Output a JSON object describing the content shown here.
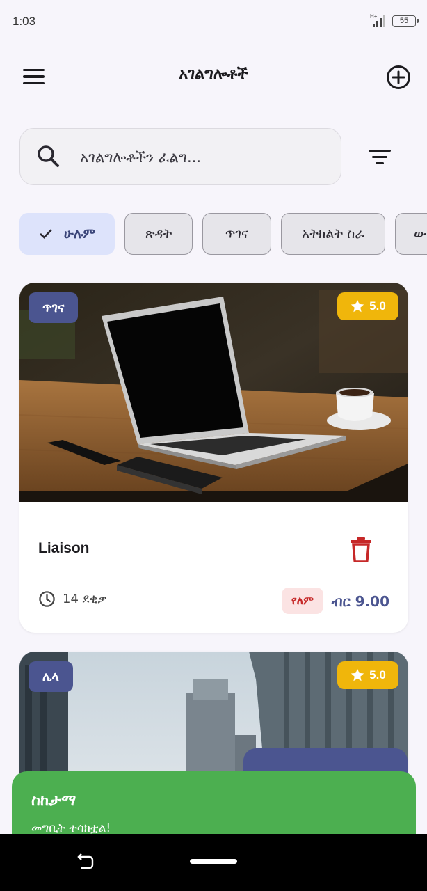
{
  "status_bar": {
    "time": "1:03",
    "battery": "55"
  },
  "app_bar": {
    "title": "አገልግሎቶች"
  },
  "search": {
    "placeholder": "አገልግሎቶችን ፈልግ..."
  },
  "filters": {
    "chips": [
      {
        "label": "ሁሉም",
        "selected": true
      },
      {
        "label": "ጽዳት",
        "selected": false
      },
      {
        "label": "ጥገና",
        "selected": false
      },
      {
        "label": "አትክልት ስራ",
        "selected": false
      },
      {
        "label": "ው",
        "selected": false
      }
    ]
  },
  "services": [
    {
      "category": "ጥገና",
      "rating": "5.0",
      "name": "Liaison",
      "duration": "14 ደቂቃ",
      "availability": "የለም",
      "price": "ብር 9.00"
    },
    {
      "category": "ሌላ",
      "rating": "5.0"
    }
  ],
  "toast": {
    "title": "ስኬታማ",
    "message": "መግቢት ተሳክቷል!"
  },
  "colors": {
    "primary": "#4b5590",
    "rating": "#f0b60b",
    "danger": "#c62828",
    "success": "#4caf50",
    "chip_selected": "#dde3fb",
    "background": "#f7f5fb"
  },
  "icons": {
    "menu": "menu-icon",
    "add": "add-circle-icon",
    "search": "search-icon",
    "filter": "filter-icon",
    "check": "check-icon",
    "star": "star-icon",
    "delete": "trash-icon",
    "clock": "clock-icon"
  }
}
